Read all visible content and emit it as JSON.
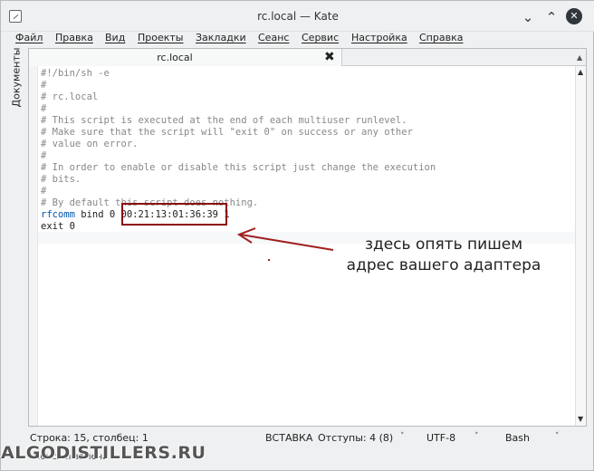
{
  "window": {
    "title": "rc.local  — Kate"
  },
  "menu": [
    "Файл",
    "Правка",
    "Вид",
    "Проекты",
    "Закладки",
    "Сеанс",
    "Сервис",
    "Настройка",
    "Справка"
  ],
  "sidebar": {
    "documents_label": "Документы"
  },
  "tab": {
    "label": "rc.local"
  },
  "code": {
    "lines": [
      "#!/bin/sh -e",
      "#",
      "# rc.local",
      "#",
      "# This script is executed at the end of each multiuser runlevel.",
      "# Make sure that the script will \"exit 0\" on success or any other",
      "# value on error.",
      "#",
      "# In order to enable or disable this script just change the execution",
      "# bits.",
      "#",
      "# By default this script does nothing."
    ],
    "rfcomm_cmd": "rfcomm",
    "rfcomm_args": " bind 0 ",
    "rfcomm_address": "00:21:13:01:36:39",
    "rfcomm_tail": " 1",
    "exit_kw": "exit",
    "exit_arg": " 0"
  },
  "annotation": {
    "line1": "здесь опять пишем",
    "line2": "адрес вашего адаптера",
    "color": "#a02020"
  },
  "status": {
    "position": "Строка: 15, столбец: 1",
    "mode": "ВСТАВКА",
    "indent": "Отступы: 4 (8)",
    "encoding": "UTF-8",
    "syntax": "Bash"
  },
  "bottom": {
    "search_tab": "Поиск и замена",
    "watermark": "ALGODISTILLERS.RU"
  }
}
